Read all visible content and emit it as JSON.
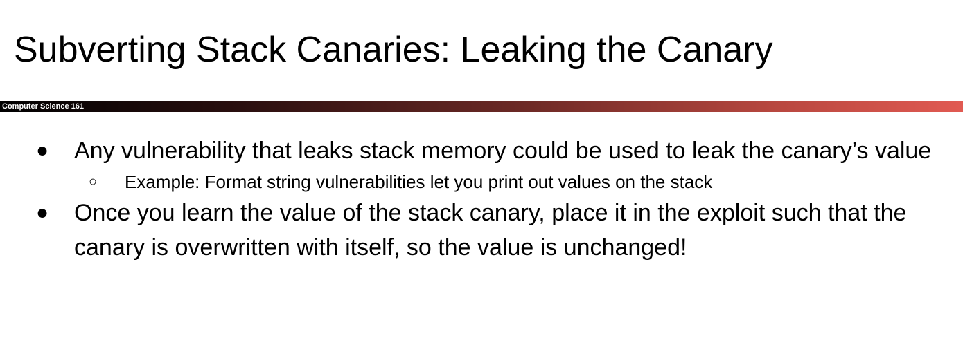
{
  "slide": {
    "title": "Subverting Stack Canaries: Leaking the Canary",
    "course_label": "Computer Science 161",
    "bullets": [
      {
        "marker": "●",
        "text": "Any vulnerability that leaks stack memory could be used to leak the canary’s value",
        "sub_bullets": [
          {
            "marker": "○",
            "text": "Example: Format string vulnerabilities let you print out values on the stack"
          }
        ]
      },
      {
        "marker": "●",
        "text": "Once you learn the value of the stack canary, place it in the exploit such that the canary is overwritten with itself, so the value is unchanged!"
      }
    ]
  },
  "colors": {
    "bar_start": "#000000",
    "bar_end": "#e15a52",
    "text": "#000000",
    "background": "#ffffff"
  }
}
